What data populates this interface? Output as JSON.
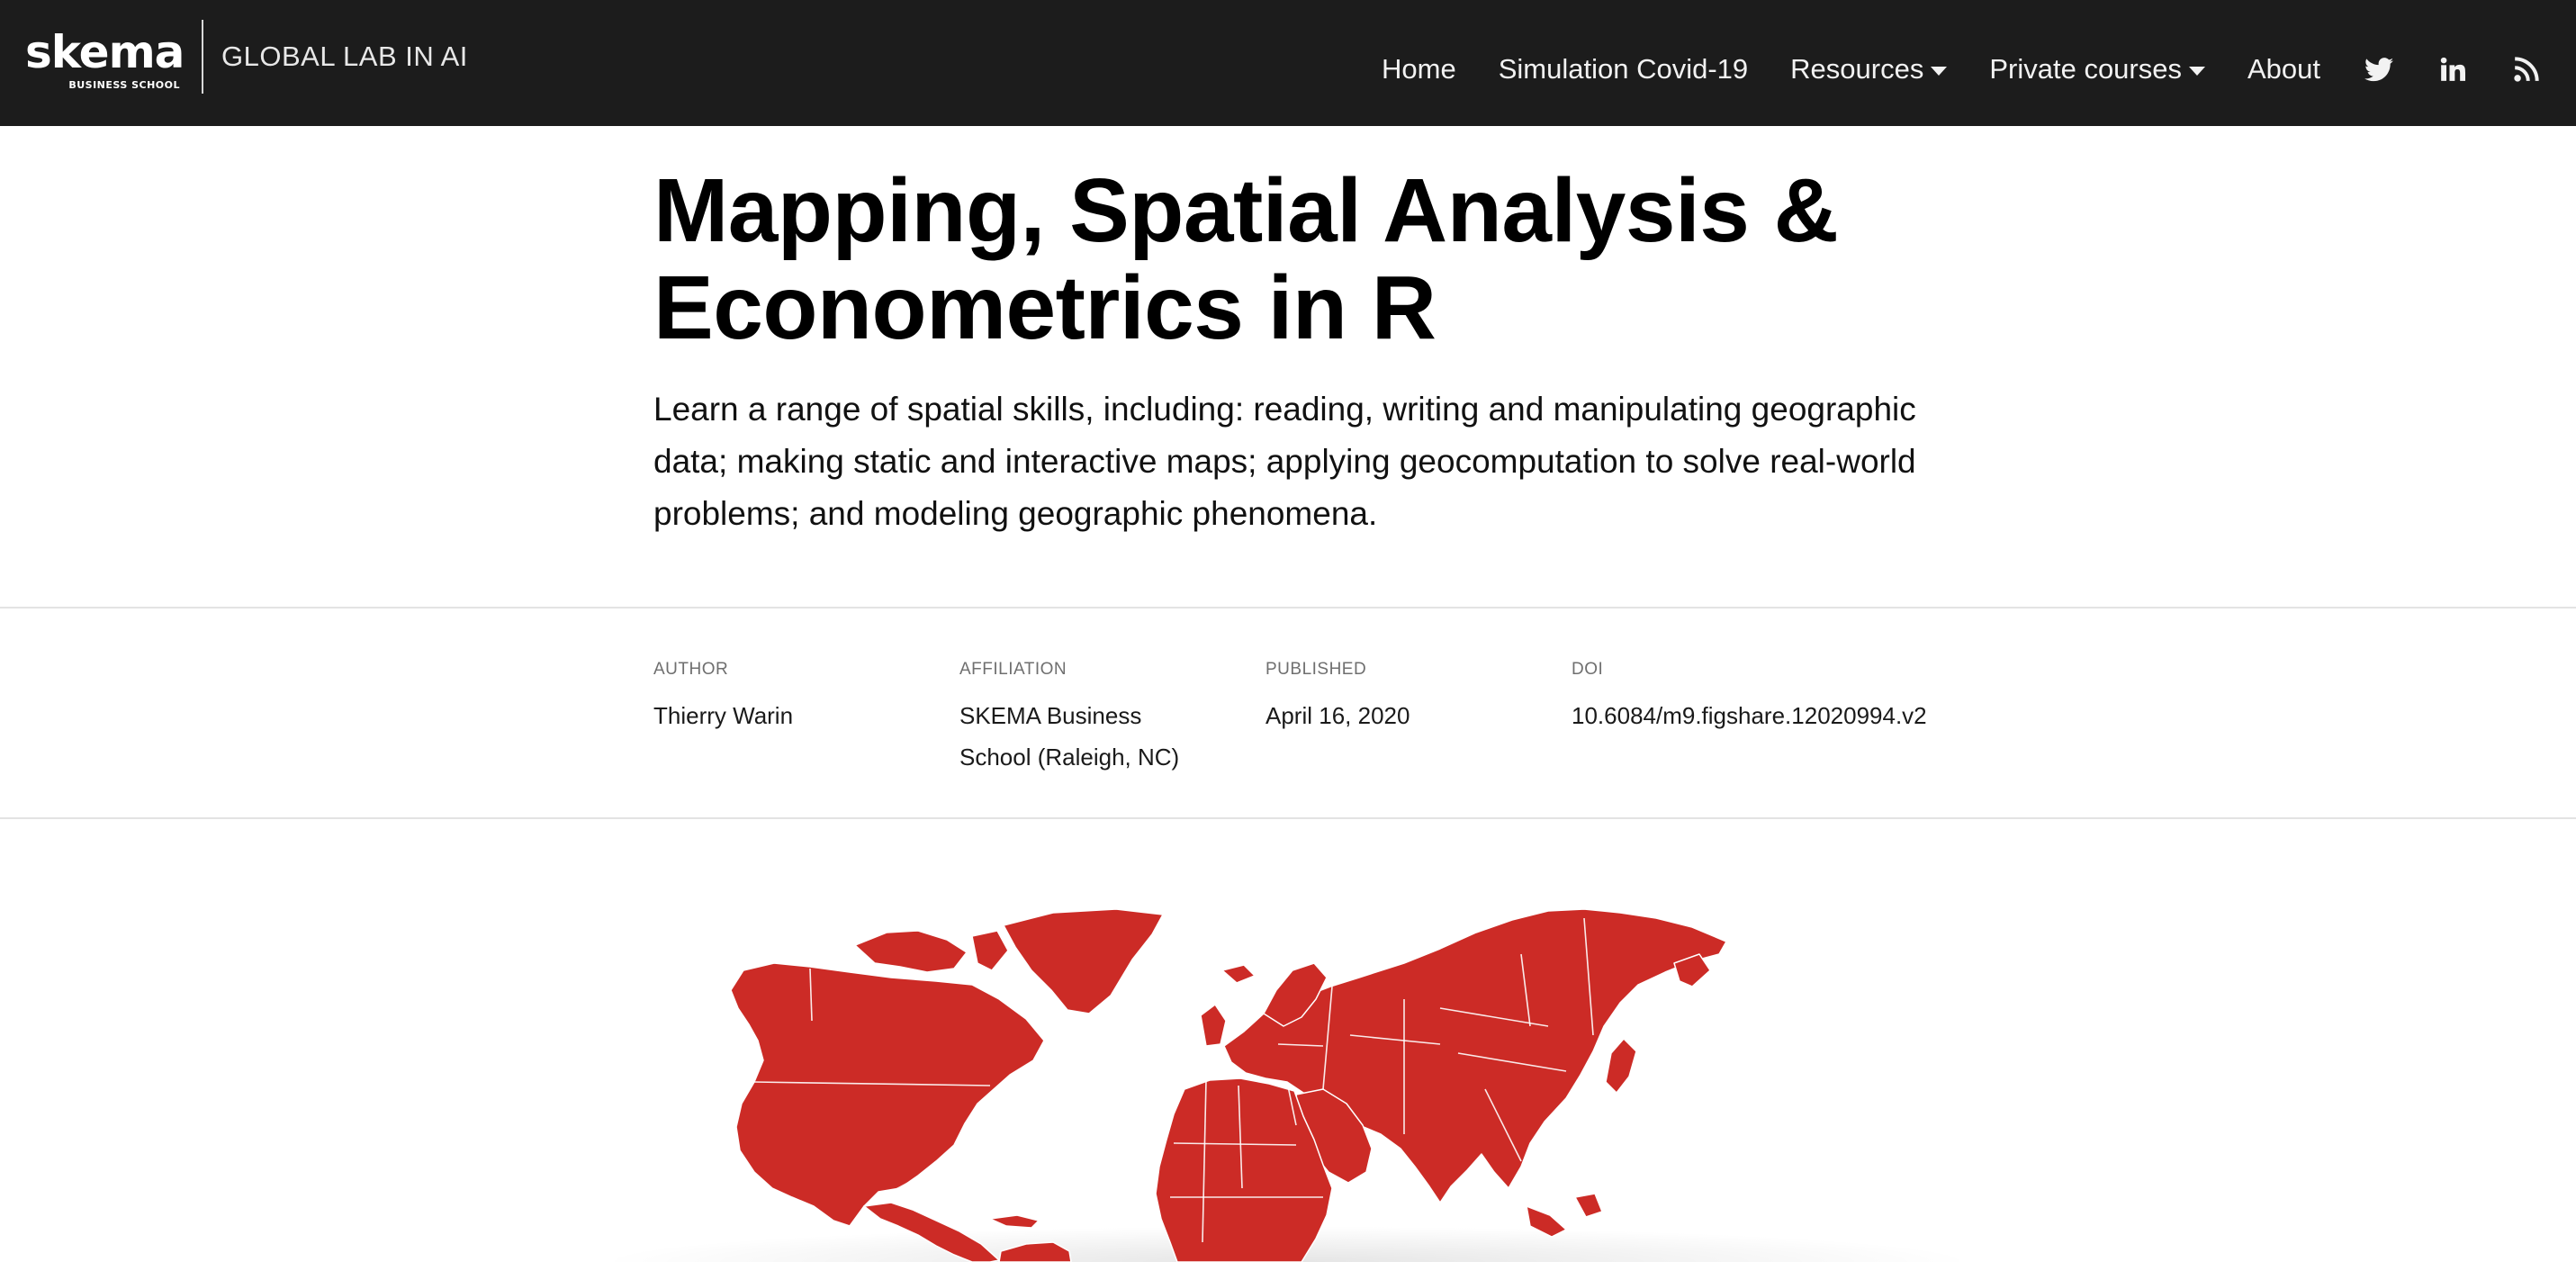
{
  "navbar": {
    "logo_text": "skema",
    "logo_subtext": "BUSINESS SCHOOL",
    "site_title": "GLOBAL LAB IN AI",
    "links": [
      {
        "label": "Home"
      },
      {
        "label": "Simulation Covid-19"
      },
      {
        "label": "Resources",
        "dropdown": true
      },
      {
        "label": "Private courses",
        "dropdown": true
      },
      {
        "label": "About"
      }
    ],
    "icons": [
      "twitter-icon",
      "linkedin-icon",
      "rss-icon"
    ]
  },
  "article": {
    "title": "Mapping, Spatial Analysis & Econometrics in R",
    "description": "Learn a range of spatial skills, including: reading, writing and manipulating geographic data; making static and interactive maps; applying geocomputation to solve real-world problems; and modeling geographic phenomena."
  },
  "meta": {
    "author_label": "AUTHOR",
    "author": "Thierry Warin",
    "affiliation_label": "AFFILIATION",
    "affiliation": "SKEMA Business School (Raleigh, NC)",
    "published_label": "PUBLISHED",
    "published": "April 16, 2020",
    "doi_label": "DOI",
    "doi": "10.6084/m9.figshare.12020994.v2"
  },
  "figure": {
    "type": "world-map",
    "fill_color": "#cc2b26",
    "border_color": "#ffffff"
  }
}
